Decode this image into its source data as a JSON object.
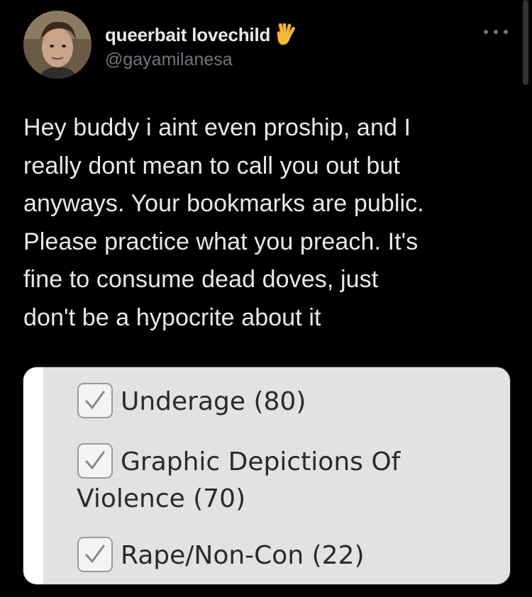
{
  "tweet": {
    "author": {
      "display_name": "queerbait lovechild",
      "handle": "@gayamilanesa",
      "badge_emoji_icon": "vulcan-salute-icon"
    },
    "menu_icon": "more-options-icon",
    "text": "Hey buddy i aint even proship, and I\nreally dont mean to call you out but\nanyways. Your bookmarks are public.\nPlease practice what you preach. It's\nfine to consume dead doves, just\ndon't be a hypocrite about it",
    "media": {
      "tags": [
        {
          "label": "Underage (80)",
          "checked": true
        },
        {
          "label": "Graphic Depictions Of\nViolence (70)",
          "checked": true
        },
        {
          "label": "Rape/Non-Con (22)",
          "checked": true
        }
      ]
    }
  },
  "colors": {
    "background": "#000000",
    "primary_text": "#e7e9ea",
    "secondary_text": "#71767b",
    "media_background": "#e2e2e2",
    "tag_text": "#2a2a2a",
    "emoji": "#f5b93a"
  }
}
